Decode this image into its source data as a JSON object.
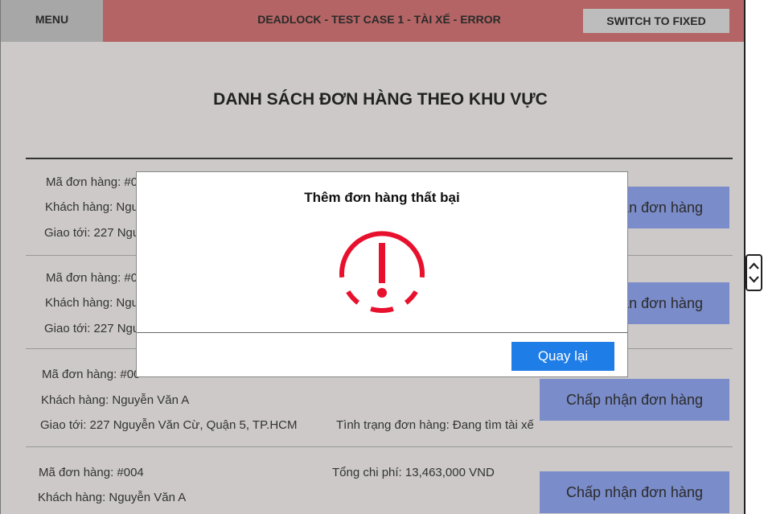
{
  "topbar": {
    "menu_label": "MENU",
    "title": "DEADLOCK - TEST CASE 1 - TÀI XẾ - ERROR",
    "switch_label": "SWITCH TO FIXED"
  },
  "page": {
    "title": "DANH SÁCH ĐƠN HÀNG THEO KHU VỰC"
  },
  "orders": [
    {
      "code": "Mã đơn hàng: #0",
      "customer": "Khách hàng: Ngu",
      "address": "Giao tới: 227 Ngu",
      "total": "",
      "status": "",
      "button": "Chấp nhận đơn hàng"
    },
    {
      "code": "Mã đơn hàng: #0",
      "customer": "Khách hàng: Ngu",
      "address": "Giao tới: 227 Ngu",
      "total": "",
      "status": "",
      "button": "Chấp nhận đơn hàng"
    },
    {
      "code": "Mã đơn hàng: #00",
      "customer": "Khách hàng: Nguyễn Văn A",
      "address": "Giao tới: 227 Nguyễn Văn Cừ, Quận 5, TP.HCM",
      "total": "",
      "status": "Tình trạng đơn hàng: Đang tìm tài xế",
      "button": "Chấp nhận đơn hàng"
    },
    {
      "code": "Mã đơn hàng: #004",
      "customer": "Khách hàng: Nguyễn Văn A",
      "address": "",
      "total": "Tổng chi phí: 13,463,000 VND",
      "status": "",
      "button": "Chấp nhận đơn hàng"
    }
  ],
  "dialog": {
    "title": "Thêm đơn hàng thất bại",
    "icon": "error-alert-icon",
    "back_label": "Quay lại",
    "accent_color": "#e8112d",
    "button_color": "#1e7de6"
  },
  "colors": {
    "topbar_bg": "#b46464",
    "page_bg": "#ccc9c8",
    "accept_button_bg": "#7a8cc9"
  }
}
